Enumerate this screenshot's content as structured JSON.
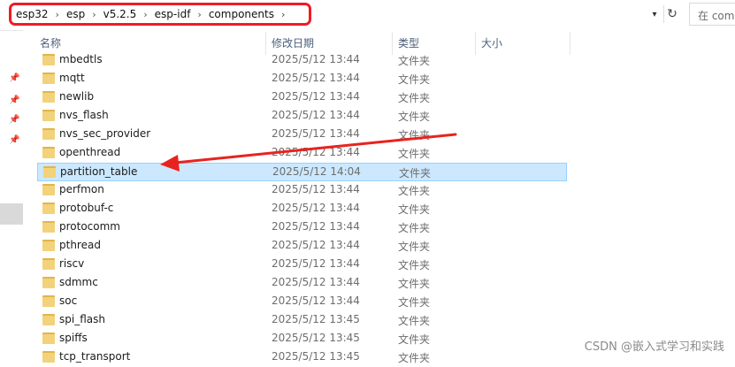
{
  "address_bar": {
    "crumbs": [
      "esp32",
      "esp",
      "v5.2.5",
      "esp-idf",
      "components"
    ],
    "search_placeholder": "在 comp"
  },
  "columns": {
    "name": "名称",
    "date": "修改日期",
    "type": "类型",
    "size": "大小"
  },
  "files": [
    {
      "name": "mbedtls",
      "date": "2025/5/12 13:44",
      "type": "文件夹"
    },
    {
      "name": "mqtt",
      "date": "2025/5/12 13:44",
      "type": "文件夹"
    },
    {
      "name": "newlib",
      "date": "2025/5/12 13:44",
      "type": "文件夹"
    },
    {
      "name": "nvs_flash",
      "date": "2025/5/12 13:44",
      "type": "文件夹"
    },
    {
      "name": "nvs_sec_provider",
      "date": "2025/5/12 13:44",
      "type": "文件夹"
    },
    {
      "name": "openthread",
      "date": "2025/5/12 13:44",
      "type": "文件夹"
    },
    {
      "name": "partition_table",
      "date": "2025/5/12 14:04",
      "type": "文件夹",
      "selected": true
    },
    {
      "name": "perfmon",
      "date": "2025/5/12 13:44",
      "type": "文件夹"
    },
    {
      "name": "protobuf-c",
      "date": "2025/5/12 13:44",
      "type": "文件夹"
    },
    {
      "name": "protocomm",
      "date": "2025/5/12 13:44",
      "type": "文件夹"
    },
    {
      "name": "pthread",
      "date": "2025/5/12 13:44",
      "type": "文件夹"
    },
    {
      "name": "riscv",
      "date": "2025/5/12 13:44",
      "type": "文件夹"
    },
    {
      "name": "sdmmc",
      "date": "2025/5/12 13:44",
      "type": "文件夹"
    },
    {
      "name": "soc",
      "date": "2025/5/12 13:44",
      "type": "文件夹"
    },
    {
      "name": "spi_flash",
      "date": "2025/5/12 13:45",
      "type": "文件夹"
    },
    {
      "name": "spiffs",
      "date": "2025/5/12 13:45",
      "type": "文件夹"
    },
    {
      "name": "tcp_transport",
      "date": "2025/5/12 13:45",
      "type": "文件夹"
    }
  ],
  "watermark": "CSDN @嵌入式学习和实践",
  "colors": {
    "highlight_box": "#ee1c25",
    "selected_row": "#cce8ff",
    "folder": "#f2d27a",
    "annotation_arrow": "#e8231f"
  },
  "icons": {
    "folder": "folder-icon",
    "pin": "pin-icon",
    "refresh": "refresh-icon",
    "dropdown": "chevron-down-icon",
    "separator": "chevron-right-icon"
  }
}
